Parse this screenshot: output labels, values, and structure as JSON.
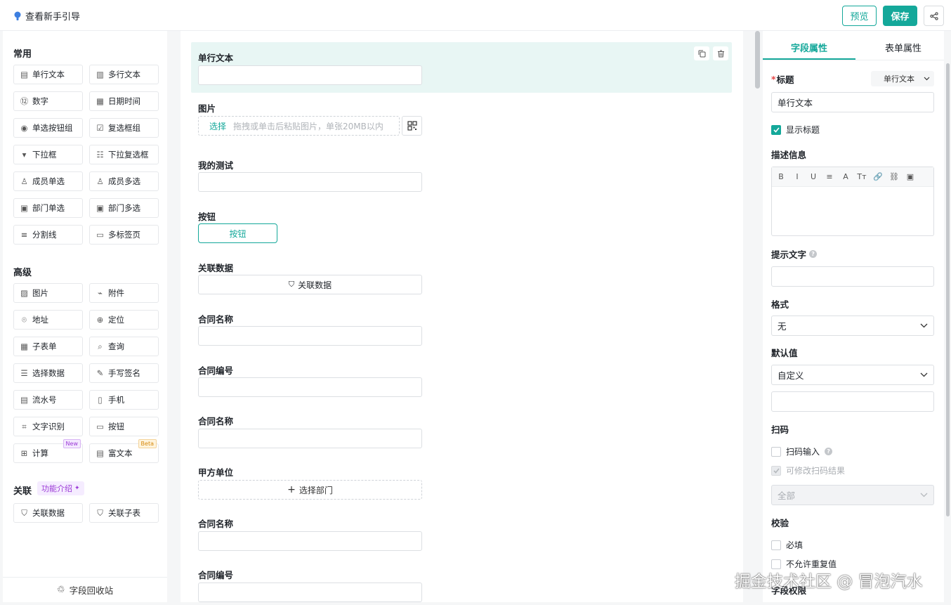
{
  "topbar": {
    "guide_label": "查看新手引导",
    "preview_label": "预览",
    "save_label": "保存"
  },
  "left": {
    "sections": [
      {
        "title": "常用",
        "items": [
          {
            "label": "单行文本",
            "icon": "single-line-icon"
          },
          {
            "label": "多行文本",
            "icon": "multi-line-icon"
          },
          {
            "label": "数字",
            "icon": "number-icon"
          },
          {
            "label": "日期时间",
            "icon": "calendar-icon"
          },
          {
            "label": "单选按钮组",
            "icon": "radio-icon"
          },
          {
            "label": "复选框组",
            "icon": "checkbox-icon"
          },
          {
            "label": "下拉框",
            "icon": "dropdown-icon"
          },
          {
            "label": "下拉复选框",
            "icon": "dropdown-multi-icon"
          },
          {
            "label": "成员单选",
            "icon": "user-icon"
          },
          {
            "label": "成员多选",
            "icon": "users-icon"
          },
          {
            "label": "部门单选",
            "icon": "dept-icon"
          },
          {
            "label": "部门多选",
            "icon": "dept-multi-icon"
          },
          {
            "label": "分割线",
            "icon": "divider-icon"
          },
          {
            "label": "多标签页",
            "icon": "tabs-icon"
          }
        ]
      },
      {
        "title": "高级",
        "items": [
          {
            "label": "图片",
            "icon": "image-icon"
          },
          {
            "label": "附件",
            "icon": "attachment-icon"
          },
          {
            "label": "地址",
            "icon": "location-pin-icon"
          },
          {
            "label": "定位",
            "icon": "locate-icon"
          },
          {
            "label": "子表单",
            "icon": "subform-icon"
          },
          {
            "label": "查询",
            "icon": "query-icon"
          },
          {
            "label": "选择数据",
            "icon": "database-icon"
          },
          {
            "label": "手写签名",
            "icon": "signature-icon"
          },
          {
            "label": "流水号",
            "icon": "serial-icon"
          },
          {
            "label": "手机",
            "icon": "phone-icon"
          },
          {
            "label": "文字识别",
            "icon": "ocr-icon"
          },
          {
            "label": "按钮",
            "icon": "button-icon"
          },
          {
            "label": "计算",
            "icon": "calc-icon",
            "badge": "New"
          },
          {
            "label": "富文本",
            "icon": "richtext-icon",
            "badge": "Beta"
          }
        ]
      },
      {
        "title": "关联",
        "items": [
          {
            "label": "关联数据",
            "icon": "link-data-icon"
          },
          {
            "label": "关联子表",
            "icon": "link-table-icon"
          }
        ]
      }
    ],
    "intro_label": "功能介绍",
    "recycle_label": "字段回收站"
  },
  "canvas": {
    "fields": [
      {
        "label": "单行文本",
        "kind": "input",
        "selected": true
      },
      {
        "label": "图片",
        "kind": "upload",
        "select_text": "选择",
        "hint": "拖拽或单击后粘贴图片，单张20MB以内"
      },
      {
        "label": "我的测试",
        "kind": "input"
      },
      {
        "label": "按钮",
        "kind": "button",
        "button_label": "按钮"
      },
      {
        "label": "关联数据",
        "kind": "relation",
        "button_label": "关联数据"
      },
      {
        "label": "合同名称",
        "kind": "input"
      },
      {
        "label": "合同编号",
        "kind": "input"
      },
      {
        "label": "合同名称",
        "kind": "input"
      },
      {
        "label": "甲方单位",
        "kind": "dept",
        "button_label": "选择部门"
      },
      {
        "label": "合同名称",
        "kind": "input"
      },
      {
        "label": "合同编号",
        "kind": "input"
      }
    ]
  },
  "right": {
    "tabs": [
      "字段属性",
      "表单属性"
    ],
    "title_label": "标题",
    "type_select": "单行文本",
    "title_value": "单行文本",
    "show_title_label": "显示标题",
    "desc_label": "描述信息",
    "rte_tools": [
      "B",
      "I",
      "U",
      "≡",
      "A",
      "Tт",
      "🔗",
      "⛓",
      "▣"
    ],
    "hint_label": "提示文字",
    "format_label": "格式",
    "format_value": "无",
    "default_label": "默认值",
    "default_value": "自定义",
    "scan_label": "扫码",
    "scan_input_label": "扫码输入",
    "scan_modify_label": "可修改扫码结果",
    "scan_scope_value": "全部",
    "validate_label": "校验",
    "required_label": "必填",
    "no_dup_label": "不允许重复值",
    "perm_label": "字段权限"
  },
  "watermark": "掘金技术社区 @ 冒泡汽水",
  "colors": {
    "accent": "#14a89a",
    "new": "#9b39d6",
    "beta": "#d68a10"
  }
}
